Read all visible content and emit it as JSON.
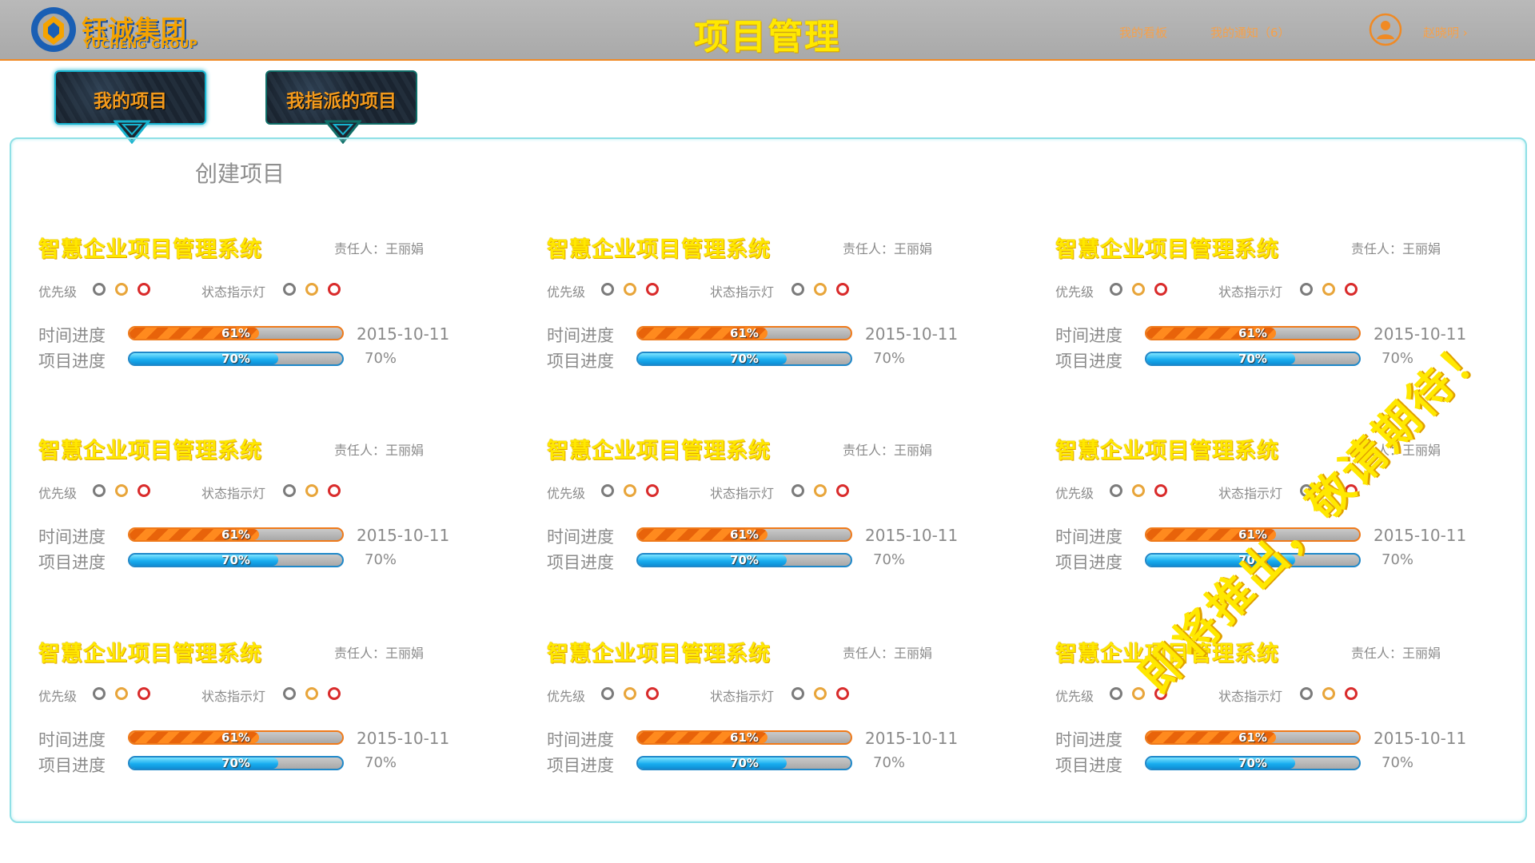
{
  "header": {
    "logo_cn": "钰诚集团",
    "logo_en": "YUCHENG GROUP",
    "title": "项目管理",
    "nav_board": "我的看板",
    "nav_notify": "我的通知（6）",
    "user_name": "赵晓明 ›"
  },
  "tabs": [
    {
      "label": "我的项目",
      "active": true
    },
    {
      "label": "我指派的项目",
      "active": false
    }
  ],
  "create_project": "创建项目",
  "labels": {
    "priority": "优先级",
    "status": "状态指示灯",
    "time_progress": "时间进度",
    "project_progress": "项目进度"
  },
  "projects": [
    {
      "title": "智慧企业项目管理系统",
      "owner": "责任人：王丽娟",
      "time_percent": 61,
      "time_label": "61%",
      "date": "2015-10-11",
      "proj_percent": 70,
      "proj_label": "70%",
      "proj_value": "70%"
    },
    {
      "title": "智慧企业项目管理系统",
      "owner": "责任人：王丽娟",
      "time_percent": 61,
      "time_label": "61%",
      "date": "2015-10-11",
      "proj_percent": 70,
      "proj_label": "70%",
      "proj_value": "70%"
    },
    {
      "title": "智慧企业项目管理系统",
      "owner": "责任人：王丽娟",
      "time_percent": 61,
      "time_label": "61%",
      "date": "2015-10-11",
      "proj_percent": 70,
      "proj_label": "70%",
      "proj_value": "70%"
    },
    {
      "title": "智慧企业项目管理系统",
      "owner": "责任人：王丽娟",
      "time_percent": 61,
      "time_label": "61%",
      "date": "2015-10-11",
      "proj_percent": 70,
      "proj_label": "70%",
      "proj_value": "70%"
    },
    {
      "title": "智慧企业项目管理系统",
      "owner": "责任人：王丽娟",
      "time_percent": 61,
      "time_label": "61%",
      "date": "2015-10-11",
      "proj_percent": 70,
      "proj_label": "70%",
      "proj_value": "70%"
    },
    {
      "title": "智慧企业项目管理系统",
      "owner": "责任人：王丽娟",
      "time_percent": 61,
      "time_label": "61%",
      "date": "2015-10-11",
      "proj_percent": 70,
      "proj_label": "70%",
      "proj_value": "70%"
    },
    {
      "title": "智慧企业项目管理系统",
      "owner": "责任人：王丽娟",
      "time_percent": 61,
      "time_label": "61%",
      "date": "2015-10-11",
      "proj_percent": 70,
      "proj_label": "70%",
      "proj_value": "70%"
    },
    {
      "title": "智慧企业项目管理系统",
      "owner": "责任人：王丽娟",
      "time_percent": 61,
      "time_label": "61%",
      "date": "2015-10-11",
      "proj_percent": 70,
      "proj_label": "70%",
      "proj_value": "70%"
    },
    {
      "title": "智慧企业项目管理系统",
      "owner": "责任人：王丽娟",
      "time_percent": 61,
      "time_label": "61%",
      "date": "2015-10-11",
      "proj_percent": 70,
      "proj_label": "70%",
      "proj_value": "70%"
    }
  ],
  "indicator_colors": [
    "#7b7b7b",
    "#e8a53a",
    "#d92b2b"
  ],
  "watermark": "即将推出，敬请期待！"
}
